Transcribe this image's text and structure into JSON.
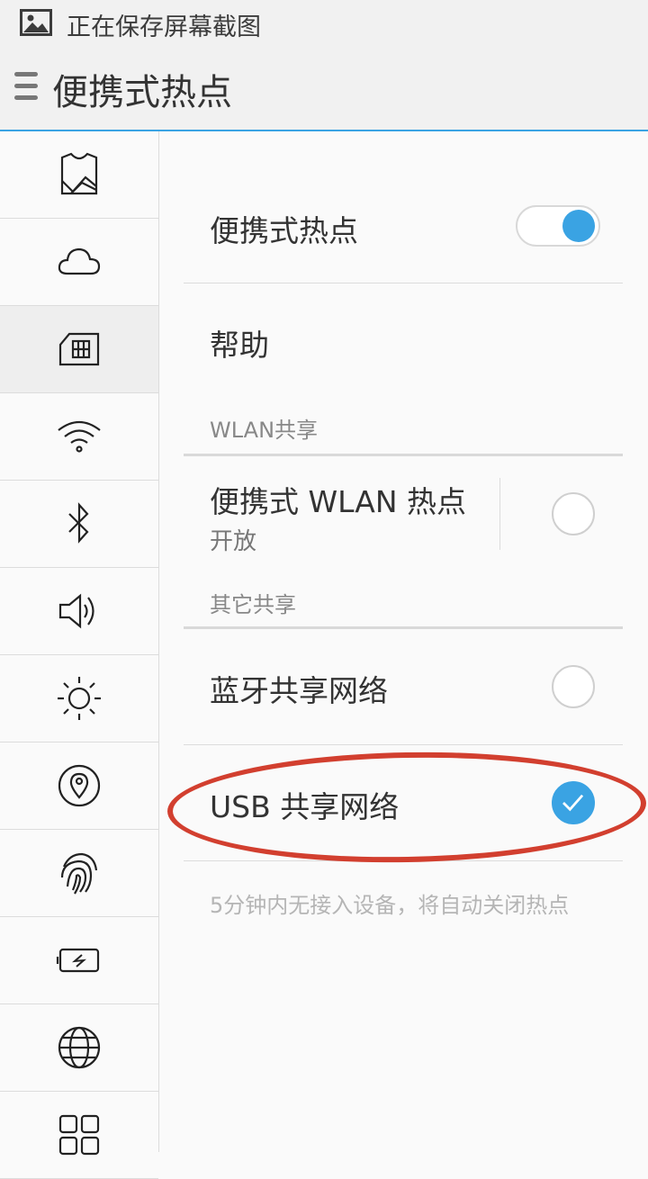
{
  "status_bar": {
    "text": "正在保存屏幕截图",
    "icon": "image-icon"
  },
  "header": {
    "title": "便携式热点",
    "menu_icon": "menu-icon"
  },
  "sidebar": {
    "items": [
      {
        "icon": "theme-icon",
        "active": false
      },
      {
        "icon": "cloud-icon",
        "active": false
      },
      {
        "icon": "sim-card-icon",
        "active": true
      },
      {
        "icon": "wifi-icon",
        "active": false
      },
      {
        "icon": "bluetooth-icon",
        "active": false
      },
      {
        "icon": "sound-icon",
        "active": false
      },
      {
        "icon": "brightness-icon",
        "active": false
      },
      {
        "icon": "location-icon",
        "active": false
      },
      {
        "icon": "fingerprint-icon",
        "active": false
      },
      {
        "icon": "battery-icon",
        "active": false
      },
      {
        "icon": "globe-icon",
        "active": false
      },
      {
        "icon": "apps-icon",
        "active": false
      }
    ]
  },
  "main": {
    "hotspot": {
      "label": "便携式热点",
      "enabled": true
    },
    "help": {
      "label": "帮助"
    },
    "wlan_section": {
      "header": "WLAN共享"
    },
    "wlan_hotspot": {
      "label": "便携式 WLAN 热点",
      "status": "开放",
      "checked": false
    },
    "other_section": {
      "header": "其它共享"
    },
    "bluetooth_tether": {
      "label": "蓝牙共享网络",
      "checked": false
    },
    "usb_tether": {
      "label": "USB 共享网络",
      "checked": true
    },
    "footnote": "5分钟内无接入设备，将自动关闭热点"
  },
  "colors": {
    "accent": "#3aa3e3",
    "annotation": "#d23f2f"
  }
}
